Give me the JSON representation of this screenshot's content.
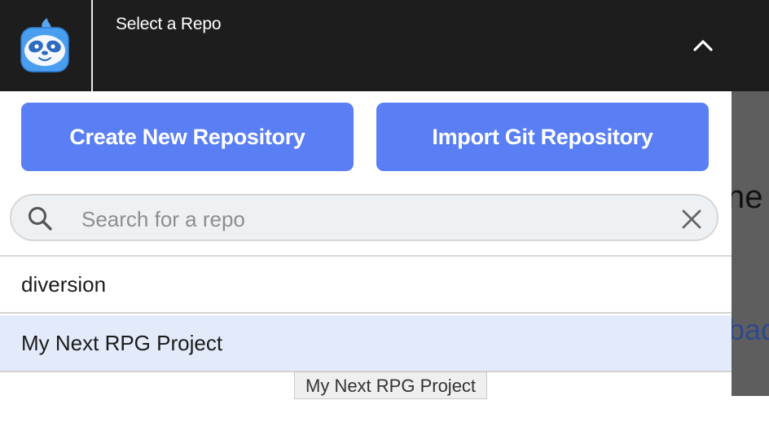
{
  "header": {
    "title": "Select a Repo",
    "logo_icon": "sloth-logo-icon",
    "toggle_icon": "chevron-up-icon"
  },
  "actions": {
    "create_label": "Create New Repository",
    "import_label": "Import Git Repository"
  },
  "search": {
    "placeholder": "Search for a repo",
    "value": ""
  },
  "repos": [
    {
      "label": "diversion"
    },
    {
      "label": "My Next RPG Project",
      "highlighted": true
    },
    {
      "label": ""
    }
  ],
  "tooltip": {
    "text": "My Next RPG Project"
  },
  "background": {
    "text_1": "ne",
    "text_2": "bad"
  },
  "colors": {
    "header_bg": "#1d1d1d",
    "accent": "#5a7ff5",
    "highlight_row": "#e3eafa"
  }
}
